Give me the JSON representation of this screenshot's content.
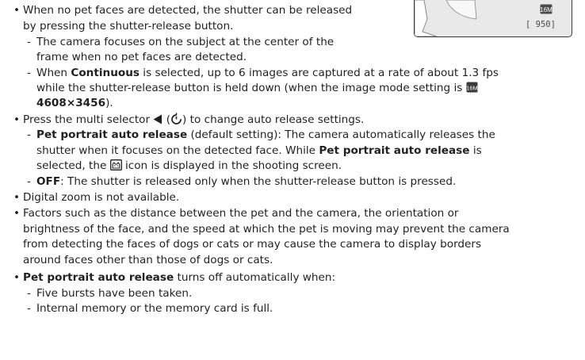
{
  "camera_preview": {
    "mode_icon": "image-mode-16M-icon",
    "remaining_frames": "[ 950]"
  },
  "bullets": [
    {
      "line1": "When no pet faces are detected, the shutter can be released",
      "line2": "by pressing the shutter-release button.",
      "subs": [
        {
          "line1": "The camera focuses on the subject at the center of the",
          "line2": "frame when no pet faces are detected."
        },
        {
          "line1_pre": "When ",
          "line1_bold": "Continuous",
          "line1_post": " is selected, up to 6 images are captured at a rate of about 1.3 fps",
          "line2": "while the shutter-release button is held down (when the image mode setting is",
          "line3_bold": "4608×3456",
          "line3_post": ")."
        }
      ]
    },
    {
      "pre": "Press the multi selector ",
      "post": " to change auto release settings.",
      "subs": [
        {
          "line1_bold": "Pet portrait auto release",
          "line1_post": " (default setting): The camera automatically releases the",
          "line2_pre": "shutter when it focuses on the detected face. While ",
          "line2_bold": "Pet portrait auto release",
          "line2_post": " is",
          "line3_pre": "selected, the ",
          "line3_post": " icon is displayed in the shooting screen."
        },
        {
          "bold": "OFF",
          "post": ": The shutter is released only when the shutter-release button is pressed."
        }
      ]
    },
    {
      "text": "Digital zoom is not available."
    },
    {
      "line1": "Factors such as the distance between the pet and the camera, the orientation or",
      "line2": "brightness of the face, and the speed at which the pet is moving may prevent the camera",
      "line3": "from detecting the faces of dogs or cats or may cause the camera to display borders",
      "line4": "around faces other than those of dogs or cats."
    },
    {
      "bold": "Pet portrait auto release",
      "post": " turns off automatically when:",
      "subs": [
        {
          "text": "Five bursts have been taken."
        },
        {
          "text": "Internal memory or the memory card is full."
        }
      ]
    }
  ]
}
